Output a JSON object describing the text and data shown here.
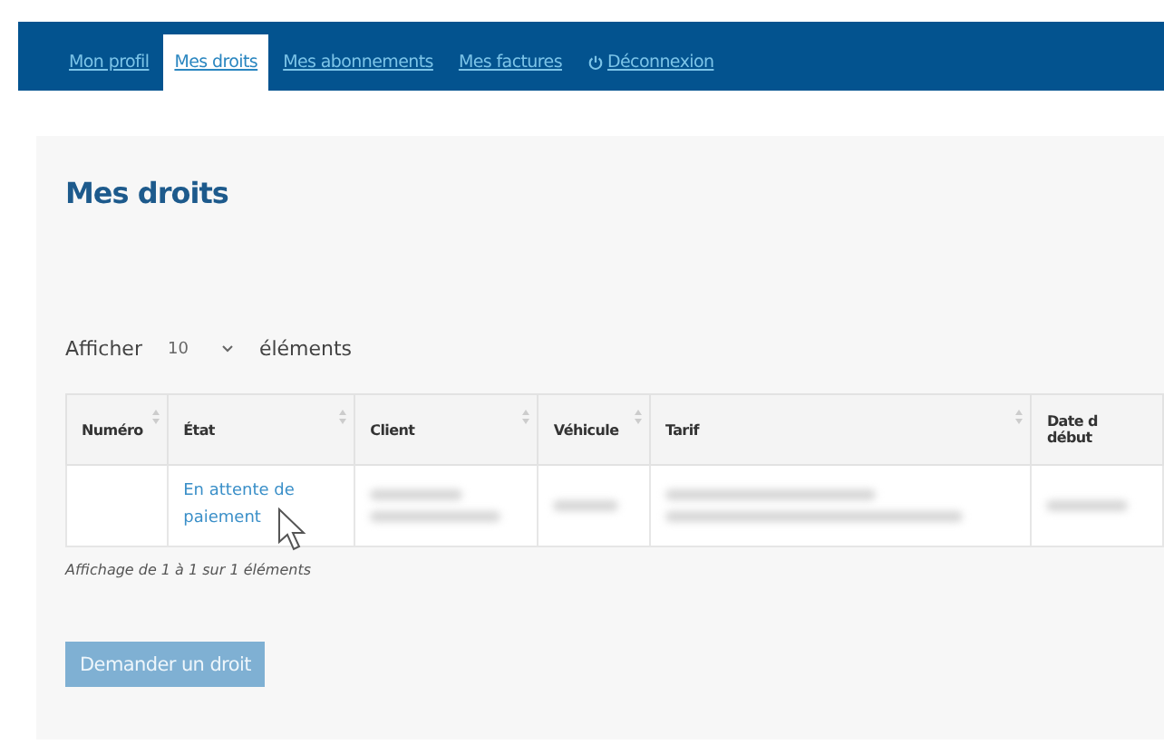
{
  "nav": {
    "tabs": [
      {
        "label": "Mon profil",
        "selected": false,
        "kind": "link"
      },
      {
        "label": "Mes droits",
        "selected": true,
        "kind": "link"
      },
      {
        "label": "Mes abonnements",
        "selected": false,
        "kind": "link"
      },
      {
        "label": "Mes factures",
        "selected": false,
        "kind": "link"
      },
      {
        "label": "Déconnexion",
        "selected": false,
        "kind": "logout"
      }
    ]
  },
  "page": {
    "title": "Mes droits",
    "length_menu": {
      "before": "Afficher",
      "value": "10",
      "after": "éléments"
    },
    "table": {
      "columns": [
        "Numéro",
        "État",
        "Client",
        "Véhicule",
        "Tarif",
        "Date d\ndébut"
      ],
      "rows": [
        {
          "cells": [
            {
              "kind": "empty"
            },
            {
              "kind": "link",
              "text": "En attente de paiement"
            },
            {
              "kind": "redacted_two_lines"
            },
            {
              "kind": "redacted"
            },
            {
              "kind": "redacted_two_lines"
            },
            {
              "kind": "redacted"
            }
          ]
        }
      ]
    },
    "info": "Affichage de 1 à 1 sur 1 éléments",
    "button": "Demander un droit"
  }
}
